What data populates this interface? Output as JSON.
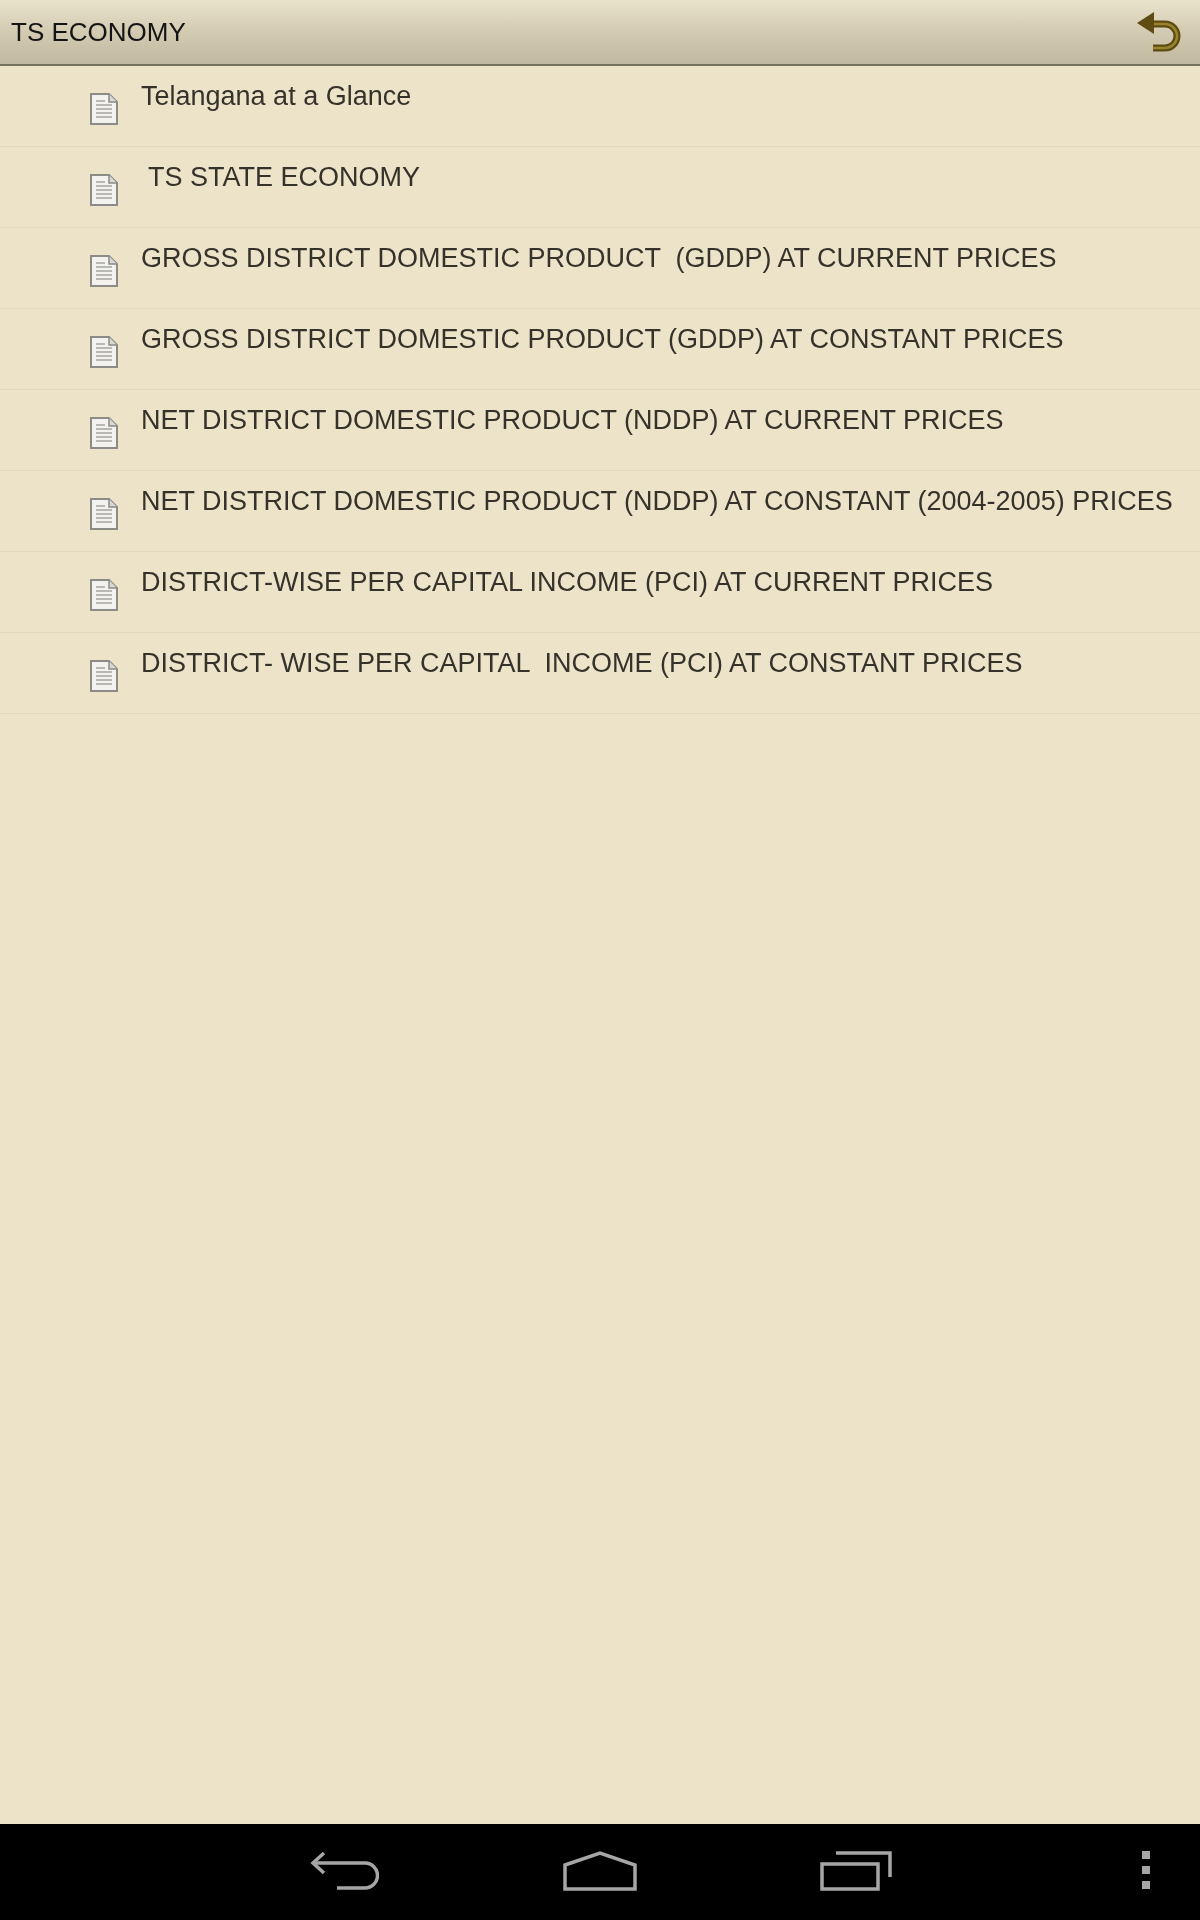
{
  "header": {
    "title": "TS ECONOMY"
  },
  "items": [
    {
      "label": "Telangana at a Glance"
    },
    {
      "label": " TS STATE ECONOMY"
    },
    {
      "label": "GROSS DISTRICT DOMESTIC PRODUCT  (GDDP) AT CURRENT PRICES"
    },
    {
      "label": "GROSS DISTRICT DOMESTIC PRODUCT (GDDP) AT CONSTANT PRICES"
    },
    {
      "label": "NET DISTRICT DOMESTIC PRODUCT (NDDP) AT CURRENT PRICES"
    },
    {
      "label": "NET DISTRICT DOMESTIC PRODUCT (NDDP) AT CONSTANT (2004-2005) PRICES"
    },
    {
      "label": "DISTRICT-WISE PER CAPITAL INCOME (PCI) AT CURRENT PRICES"
    },
    {
      "label": "DISTRICT- WISE PER CAPITAL  INCOME (PCI) AT CONSTANT PRICES"
    }
  ]
}
